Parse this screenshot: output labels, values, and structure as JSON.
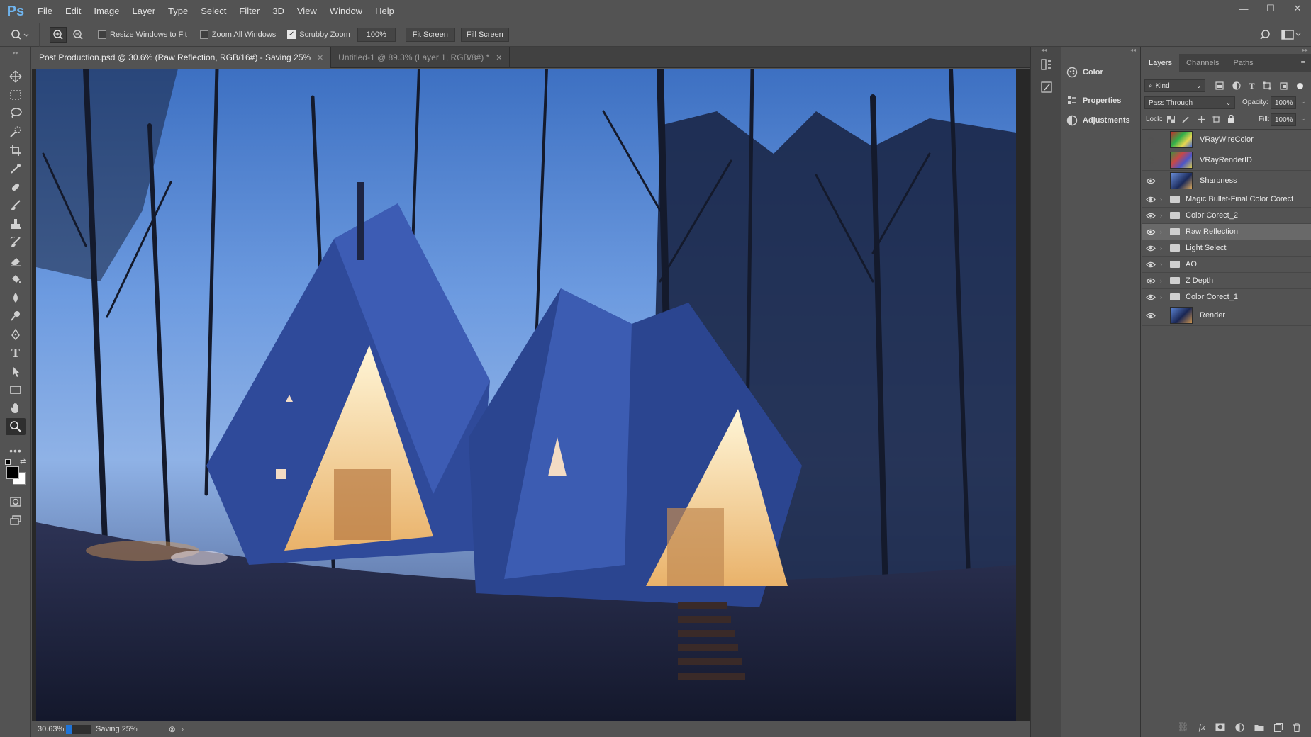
{
  "app": {
    "logo": "Ps",
    "window_controls": [
      "—",
      "☐",
      "✕"
    ]
  },
  "menu": [
    "File",
    "Edit",
    "Image",
    "Layer",
    "Type",
    "Select",
    "Filter",
    "3D",
    "View",
    "Window",
    "Help"
  ],
  "options": {
    "resize_windows": "Resize Windows to Fit",
    "zoom_all": "Zoom All Windows",
    "scrubby_zoom": "Scrubby Zoom",
    "zoom_value": "100%",
    "fit_screen": "Fit Screen",
    "fill_screen": "Fill Screen",
    "resize_checked": false,
    "zoom_all_checked": false,
    "scrubby_checked": true
  },
  "tabs": [
    {
      "label": "Post Production.psd @ 30.6% (Raw Reflection, RGB/16#) - Saving 25%",
      "active": true
    },
    {
      "label": "Untitled-1 @ 89.3% (Layer 1, RGB/8#) *",
      "active": false
    }
  ],
  "status": {
    "zoom": "30.63%",
    "saving": "Saving 25%",
    "progress": 0.25
  },
  "mini_panels": [
    "Color",
    "Properties",
    "Adjustments"
  ],
  "layers_panel": {
    "tabs": [
      "Layers",
      "Channels",
      "Paths"
    ],
    "filter": "Kind",
    "blend_mode": "Pass Through",
    "opacity_label": "Opacity:",
    "opacity": "100%",
    "lock_label": "Lock:",
    "fill_label": "Fill:",
    "fill": "100%",
    "layers": [
      {
        "name": "VRayWireColor",
        "type": "image",
        "visible": false,
        "selected": false
      },
      {
        "name": "VRayRenderID",
        "type": "image",
        "visible": false,
        "selected": false
      },
      {
        "name": "Sharpness",
        "type": "image",
        "visible": true,
        "selected": false
      },
      {
        "name": "Magic Bullet-Final Color Corect",
        "type": "group",
        "visible": true,
        "selected": false
      },
      {
        "name": "Color Corect_2",
        "type": "group",
        "visible": true,
        "selected": false
      },
      {
        "name": "Raw Reflection",
        "type": "group",
        "visible": true,
        "selected": true
      },
      {
        "name": "Light Select",
        "type": "group",
        "visible": true,
        "selected": false
      },
      {
        "name": "AO",
        "type": "group",
        "visible": true,
        "selected": false
      },
      {
        "name": "Z Depth",
        "type": "group",
        "visible": true,
        "selected": false
      },
      {
        "name": "Color Corect_1",
        "type": "group",
        "visible": true,
        "selected": false
      },
      {
        "name": "Render",
        "type": "image",
        "visible": true,
        "selected": false
      }
    ]
  }
}
